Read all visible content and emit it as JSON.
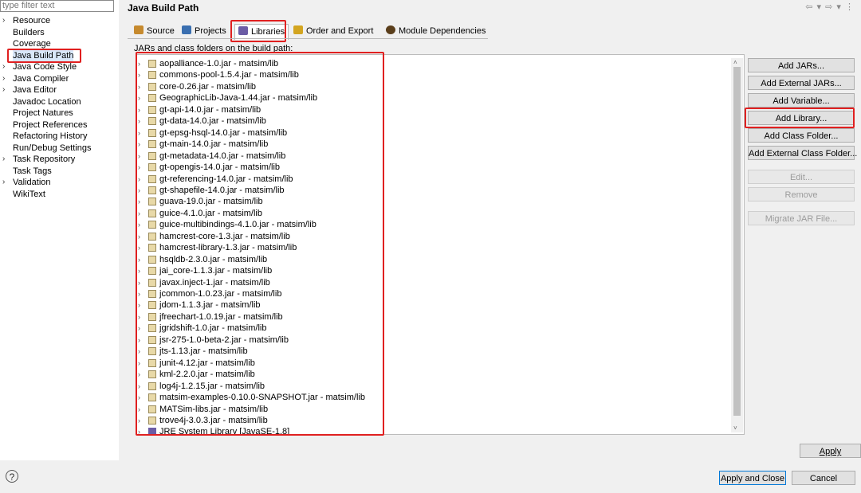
{
  "filter": {
    "placeholder": "type filter text"
  },
  "nav": [
    {
      "label": "Resource",
      "expandable": true
    },
    {
      "label": "Builders",
      "expandable": false
    },
    {
      "label": "Coverage",
      "expandable": false
    },
    {
      "label": "Java Build Path",
      "expandable": false,
      "selected": true
    },
    {
      "label": "Java Code Style",
      "expandable": true
    },
    {
      "label": "Java Compiler",
      "expandable": true
    },
    {
      "label": "Java Editor",
      "expandable": true
    },
    {
      "label": "Javadoc Location",
      "expandable": false
    },
    {
      "label": "Project Natures",
      "expandable": false
    },
    {
      "label": "Project References",
      "expandable": false
    },
    {
      "label": "Refactoring History",
      "expandable": false
    },
    {
      "label": "Run/Debug Settings",
      "expandable": false
    },
    {
      "label": "Task Repository",
      "expandable": true
    },
    {
      "label": "Task Tags",
      "expandable": false
    },
    {
      "label": "Validation",
      "expandable": true
    },
    {
      "label": "WikiText",
      "expandable": false
    }
  ],
  "page": {
    "title": "Java Build Path",
    "caption": "JARs and class folders on the build path:"
  },
  "tabs": [
    {
      "label": "Source",
      "icon": "source-folder-icon"
    },
    {
      "label": "Projects",
      "icon": "projects-icon"
    },
    {
      "label": "Libraries",
      "icon": "libraries-icon",
      "active": true
    },
    {
      "label": "Order and Export",
      "icon": "order-export-icon"
    },
    {
      "label": "Module Dependencies",
      "icon": "module-dependencies-icon"
    }
  ],
  "jars": [
    "aopalliance-1.0.jar - matsim/lib",
    "commons-pool-1.5.4.jar - matsim/lib",
    "core-0.26.jar - matsim/lib",
    "GeographicLib-Java-1.44.jar - matsim/lib",
    "gt-api-14.0.jar - matsim/lib",
    "gt-data-14.0.jar - matsim/lib",
    "gt-epsg-hsql-14.0.jar - matsim/lib",
    "gt-main-14.0.jar - matsim/lib",
    "gt-metadata-14.0.jar - matsim/lib",
    "gt-opengis-14.0.jar - matsim/lib",
    "gt-referencing-14.0.jar - matsim/lib",
    "gt-shapefile-14.0.jar - matsim/lib",
    "guava-19.0.jar - matsim/lib",
    "guice-4.1.0.jar - matsim/lib",
    "guice-multibindings-4.1.0.jar - matsim/lib",
    "hamcrest-core-1.3.jar - matsim/lib",
    "hamcrest-library-1.3.jar - matsim/lib",
    "hsqldb-2.3.0.jar - matsim/lib",
    "jai_core-1.1.3.jar - matsim/lib",
    "javax.inject-1.jar - matsim/lib",
    "jcommon-1.0.23.jar - matsim/lib",
    "jdom-1.1.3.jar - matsim/lib",
    "jfreechart-1.0.19.jar - matsim/lib",
    "jgridshift-1.0.jar - matsim/lib",
    "jsr-275-1.0-beta-2.jar - matsim/lib",
    "jts-1.13.jar - matsim/lib",
    "junit-4.12.jar - matsim/lib",
    "kml-2.2.0.jar - matsim/lib",
    "log4j-1.2.15.jar - matsim/lib",
    "matsim-examples-0.10.0-SNAPSHOT.jar - matsim/lib",
    "MATSim-libs.jar - matsim/lib",
    "trove4j-3.0.3.jar - matsim/lib",
    "JRE System Library [JavaSE-1.8]"
  ],
  "buttons": [
    {
      "label": "Add JARs...",
      "enabled": true
    },
    {
      "label": "Add External JARs...",
      "enabled": true
    },
    {
      "label": "Add Variable...",
      "enabled": true
    },
    {
      "label": "Add Library...",
      "enabled": true,
      "highlighted": true
    },
    {
      "label": "Add Class Folder...",
      "enabled": true
    },
    {
      "label": "Add External Class Folder...",
      "enabled": true
    },
    {
      "label": "Edit...",
      "enabled": false
    },
    {
      "label": "Remove",
      "enabled": false
    },
    {
      "label": "Migrate JAR File...",
      "enabled": false
    }
  ],
  "footer": {
    "apply": "Apply",
    "apply_close": "Apply and Close",
    "cancel": "Cancel",
    "help": "?"
  },
  "colors": {
    "highlight": "#e02020",
    "selection": "#d9e7f9"
  }
}
